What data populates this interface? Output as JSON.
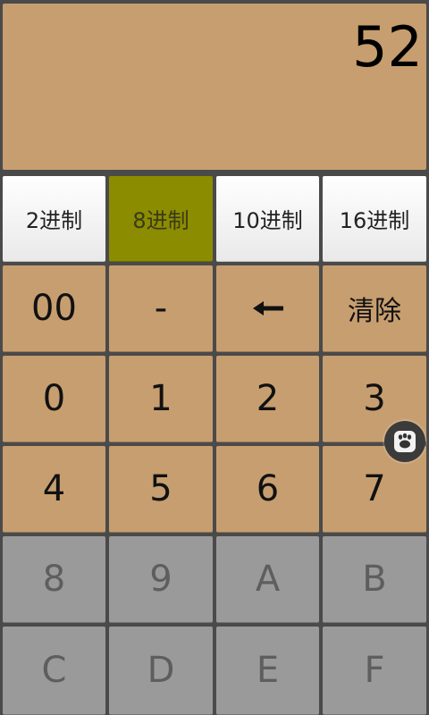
{
  "display": {
    "value": "52"
  },
  "base_buttons": [
    {
      "label": "2进制"
    },
    {
      "label": "8进制",
      "active": true
    },
    {
      "label": "10进制"
    },
    {
      "label": "16进制"
    }
  ],
  "keys": {
    "double_zero": "00",
    "minus": "-",
    "backspace": "←",
    "clear": "清除",
    "d0": "0",
    "d1": "1",
    "d2": "2",
    "d3": "3",
    "d4": "4",
    "d5": "5",
    "d6": "6",
    "d7": "7",
    "d8": "8",
    "d9": "9",
    "hA": "A",
    "hB": "B",
    "hC": "C",
    "hD": "D",
    "hE": "E",
    "hF": "F"
  },
  "floating_button": {
    "icon": "paw-icon"
  },
  "colors": {
    "display_bg": "#c79e6f",
    "key_bg": "#c79e6f",
    "active_base_bg": "#8c8c00",
    "disabled_key_bg": "#9a9a9a"
  }
}
